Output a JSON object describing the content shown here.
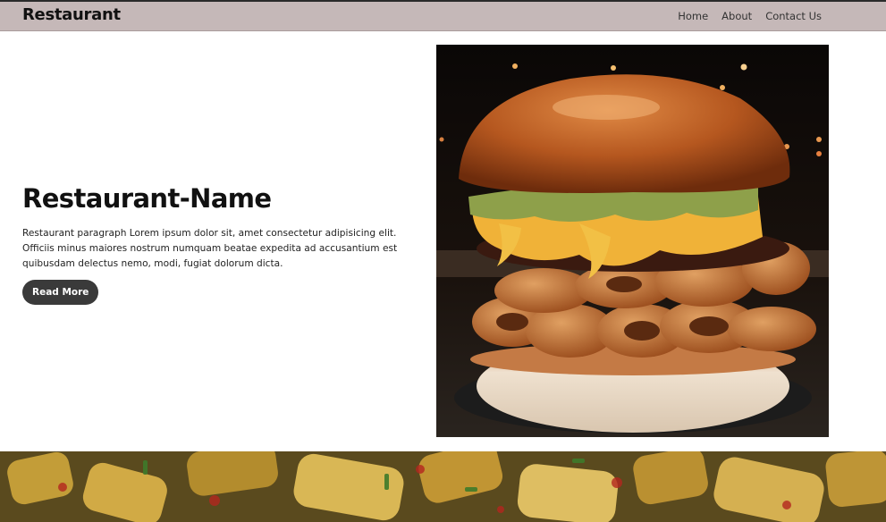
{
  "nav": {
    "brand": "Restaurant",
    "links": [
      "Home",
      "About",
      "Contact Us"
    ]
  },
  "hero": {
    "title": "Restaurant-Name",
    "paragraph": "Restaurant paragraph Lorem ipsum dolor sit, amet consectetur adipisicing elit. Officiis minus maiores nostrum numquam beatae expedita ad accusantium est quibusdam delectus nemo, modi, fugiat dolorum dicta.",
    "button_label": "Read More"
  },
  "colors": {
    "navbar_bg": "#c5b8b8",
    "button_bg": "#3a3a3a"
  }
}
